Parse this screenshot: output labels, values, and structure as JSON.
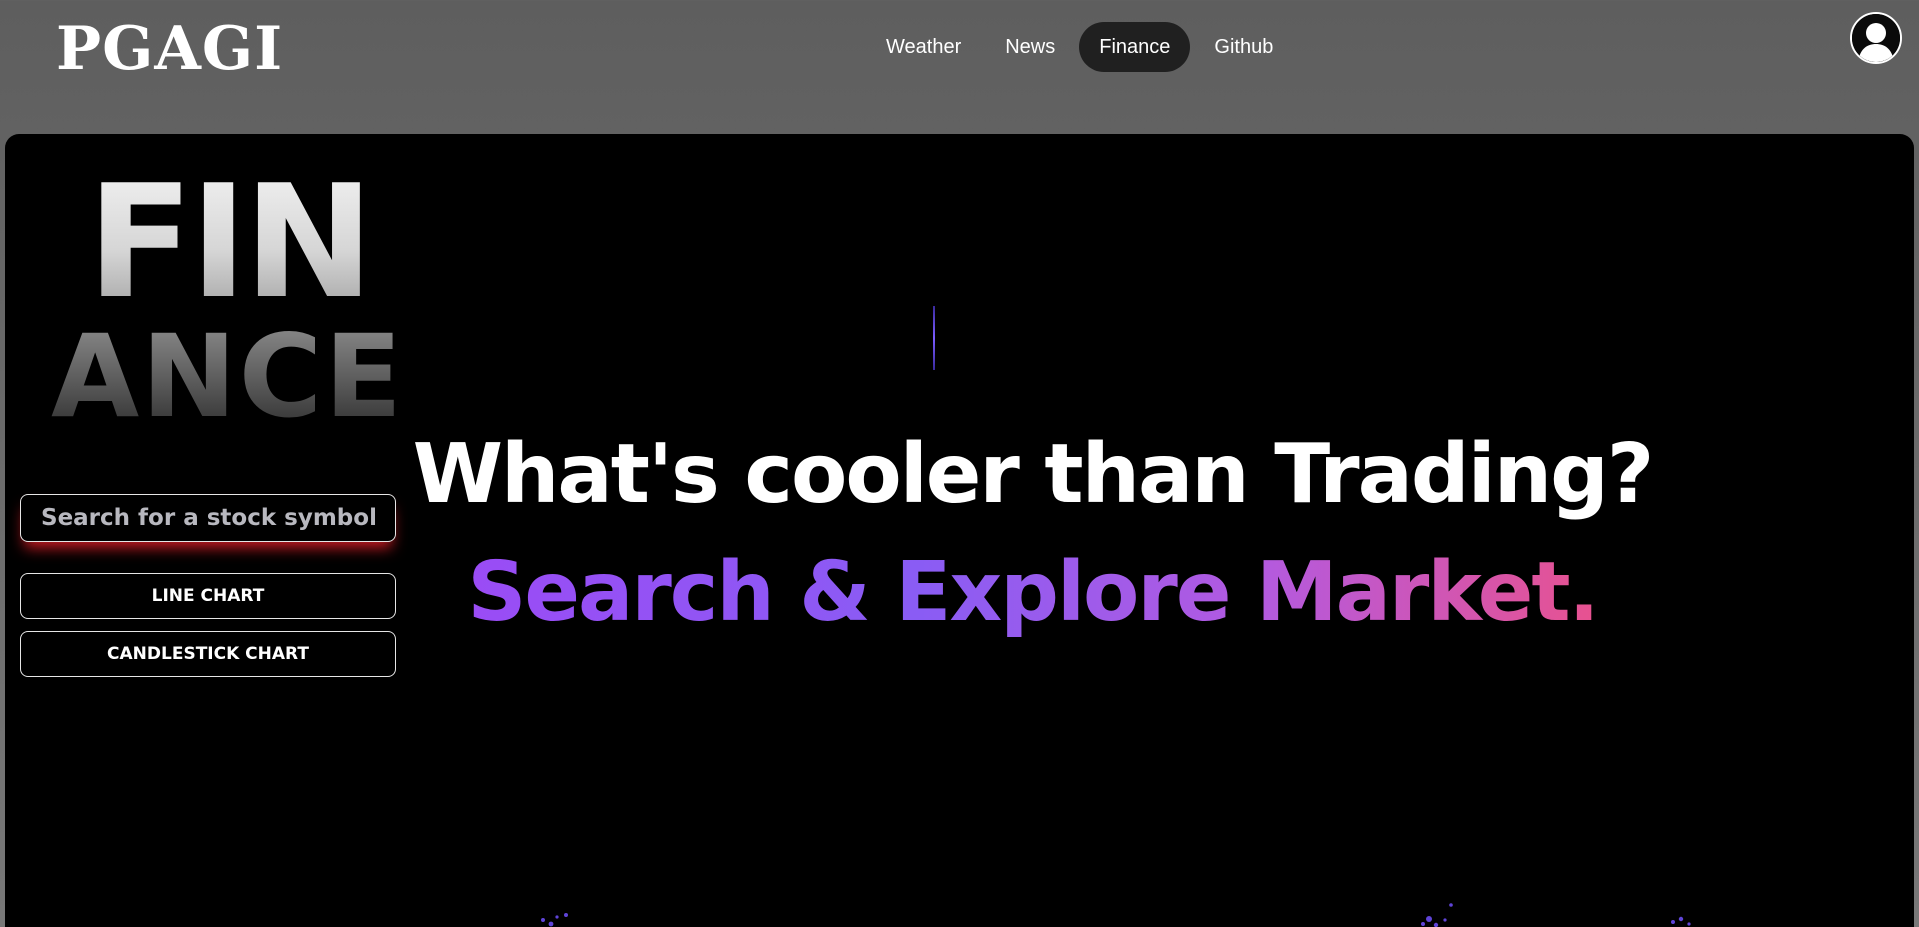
{
  "header": {
    "logo": "PGAGI",
    "nav": [
      {
        "label": "Weather",
        "active": false
      },
      {
        "label": "News",
        "active": false
      },
      {
        "label": "Finance",
        "active": true
      },
      {
        "label": "Github",
        "active": false
      }
    ],
    "avatar_icon": "user-avatar-icon"
  },
  "sidebar": {
    "title_top": "FIN",
    "title_bottom": "ANCE",
    "search_placeholder": "Search for a stock symbol...",
    "search_value": "",
    "buttons": {
      "line_chart": "LINE CHART",
      "candlestick_chart": "CANDLESTICK CHART"
    }
  },
  "hero": {
    "headline": "What's cooler than Trading?",
    "subline": "Search & Explore Market."
  },
  "colors": {
    "panel_bg": "#000000",
    "accent_purple": "#9a4cf5",
    "accent_pink": "#e8528f",
    "search_glow": "#e61e28",
    "active_nav_bg": "#202020"
  }
}
